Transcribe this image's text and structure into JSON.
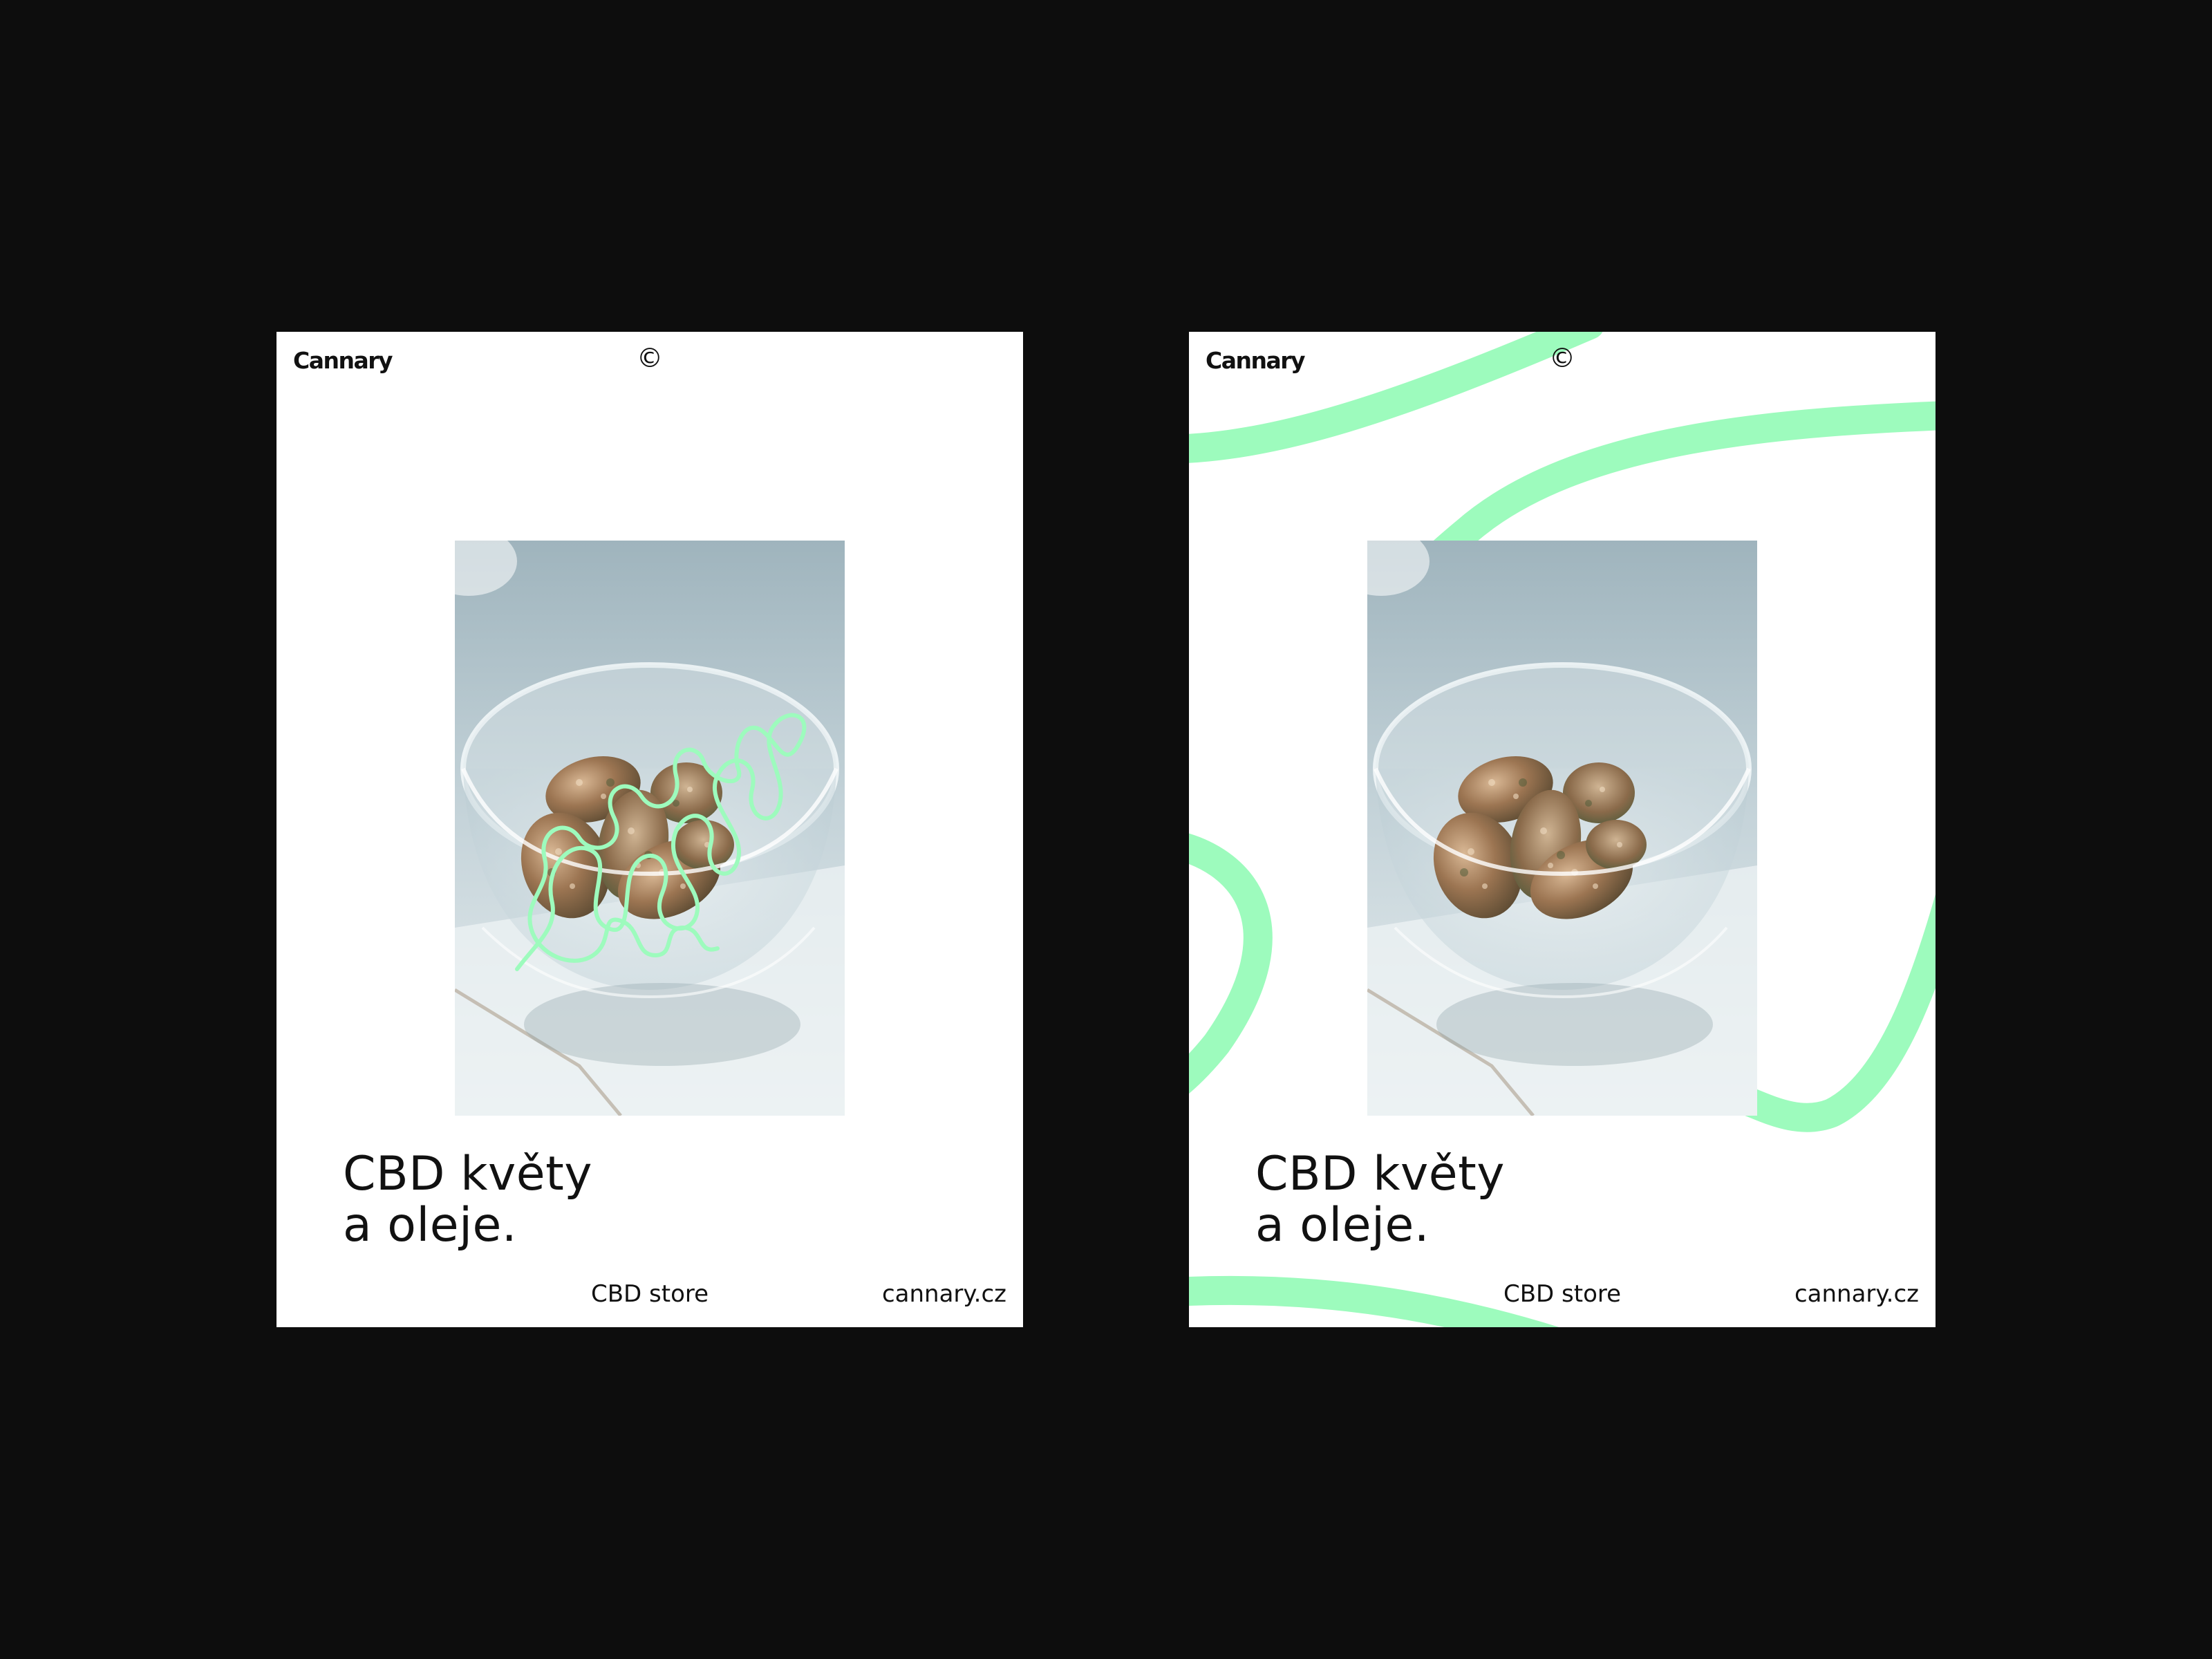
{
  "accent_color": "#9dfbbd",
  "posters": [
    {
      "variant": "scribble-overlay",
      "logo": "Cannary",
      "copyright_symbol": "©",
      "headline_line1": "CBD květy",
      "headline_line2": "a oleje.",
      "footer_label": "CBD store",
      "footer_url": "cannary.cz",
      "photo_subject": "cannabis-buds-in-glass-bowl-photo"
    },
    {
      "variant": "stroke-background",
      "logo": "Cannary",
      "copyright_symbol": "©",
      "headline_line1": "CBD květy",
      "headline_line2": "a oleje.",
      "footer_label": "CBD store",
      "footer_url": "cannary.cz",
      "photo_subject": "cannabis-buds-in-glass-bowl-photo"
    }
  ]
}
